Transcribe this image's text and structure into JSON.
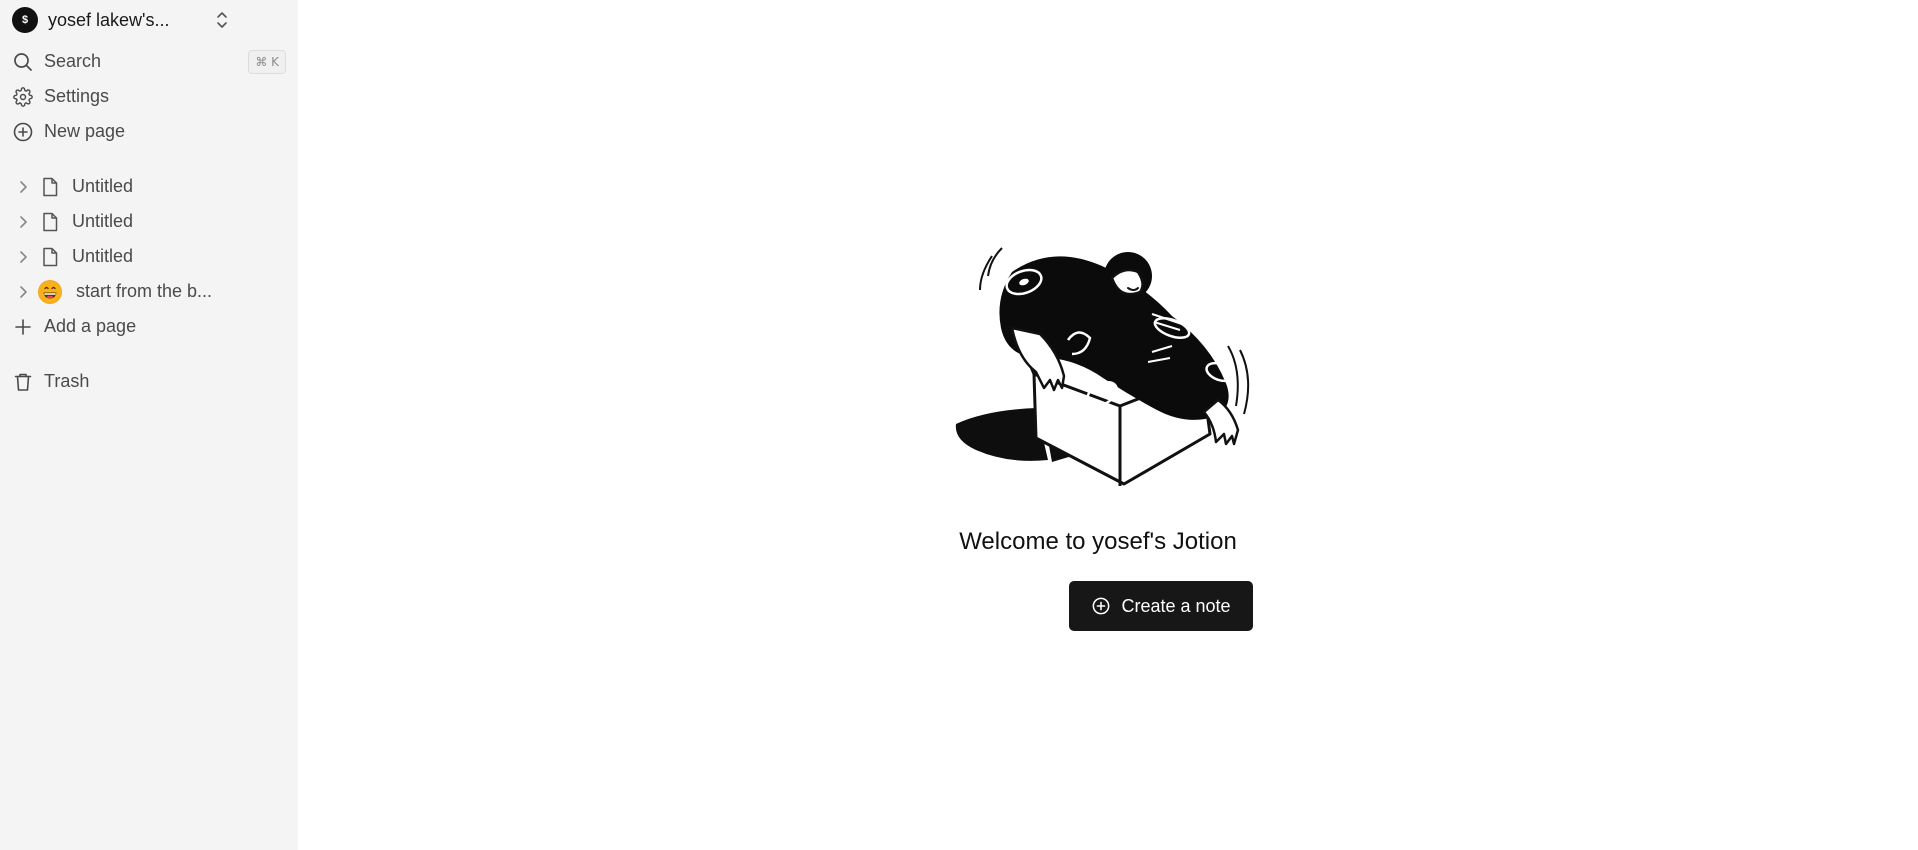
{
  "workspace": {
    "avatar_text": "$",
    "name": "yosef lakew's..."
  },
  "nav": {
    "search_label": "Search",
    "search_shortcut": "⌘ K",
    "settings_label": "Settings",
    "new_page_label": "New page"
  },
  "pages": [
    {
      "label": "Untitled",
      "icon": "document-icon"
    },
    {
      "label": "Untitled",
      "icon": "document-icon"
    },
    {
      "label": "Untitled",
      "icon": "document-icon"
    },
    {
      "label": "start from the b...",
      "icon": "grinning-emoji",
      "emoji": "😄"
    }
  ],
  "add_page_label": "Add a page",
  "trash_label": "Trash",
  "main": {
    "welcome_text": "Welcome to yosef's Jotion",
    "create_button_label": "Create a note"
  },
  "colors": {
    "sidebar_bg": "#f4f4f4",
    "button_bg": "#171717",
    "main_bg": "#ffffff"
  }
}
